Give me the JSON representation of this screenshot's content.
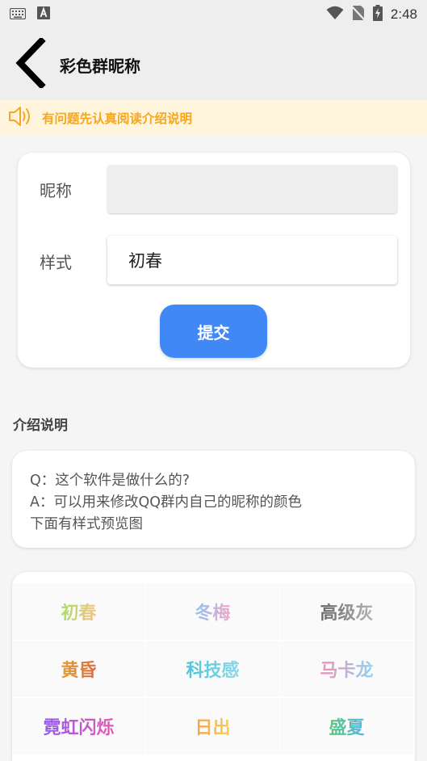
{
  "status_bar": {
    "time": "2:48",
    "icons": [
      "keyboard-icon",
      "font-a-icon",
      "wifi-icon",
      "no-sim-icon",
      "battery-charging-icon"
    ]
  },
  "app_bar": {
    "back_icon": "back-chevron-icon",
    "title": "彩色群昵称"
  },
  "notice": {
    "icon": "speaker-icon",
    "text": "有问题先认真阅读介绍说明",
    "color": "#f5a623"
  },
  "form": {
    "nickname_label": "昵称",
    "nickname_value": "",
    "style_label": "样式",
    "style_value": "初春",
    "submit_label": "提交",
    "accent": "#3f88f6"
  },
  "intro": {
    "title": "介绍说明",
    "lines": [
      "Q：这个软件是做什么的?",
      "A：可以用来修改QQ群内自己的昵称的颜色",
      "下面有样式预览图"
    ]
  },
  "styles": [
    {
      "name": "初春",
      "colors": [
        "#a8e063",
        "#f6c38a"
      ]
    },
    {
      "name": "冬梅",
      "colors": [
        "#89c4f4",
        "#f4a6c8"
      ]
    },
    {
      "name": "高级灰",
      "colors": [
        "#666666",
        "#b5b5b5"
      ]
    },
    {
      "name": "黄昏",
      "colors": [
        "#e2a032",
        "#d96a3f"
      ]
    },
    {
      "name": "科技感",
      "colors": [
        "#4fc3d8",
        "#8ad8e8"
      ]
    },
    {
      "name": "马卡龙",
      "colors": [
        "#f28fb0",
        "#8fd3f2"
      ]
    },
    {
      "name": "霓虹闪烁",
      "colors": [
        "#8e5be8",
        "#e85bb8"
      ]
    },
    {
      "name": "日出",
      "colors": [
        "#f5a04a",
        "#f7cf5a"
      ]
    },
    {
      "name": "盛夏",
      "colors": [
        "#5ac878",
        "#5ab4e8"
      ]
    }
  ]
}
